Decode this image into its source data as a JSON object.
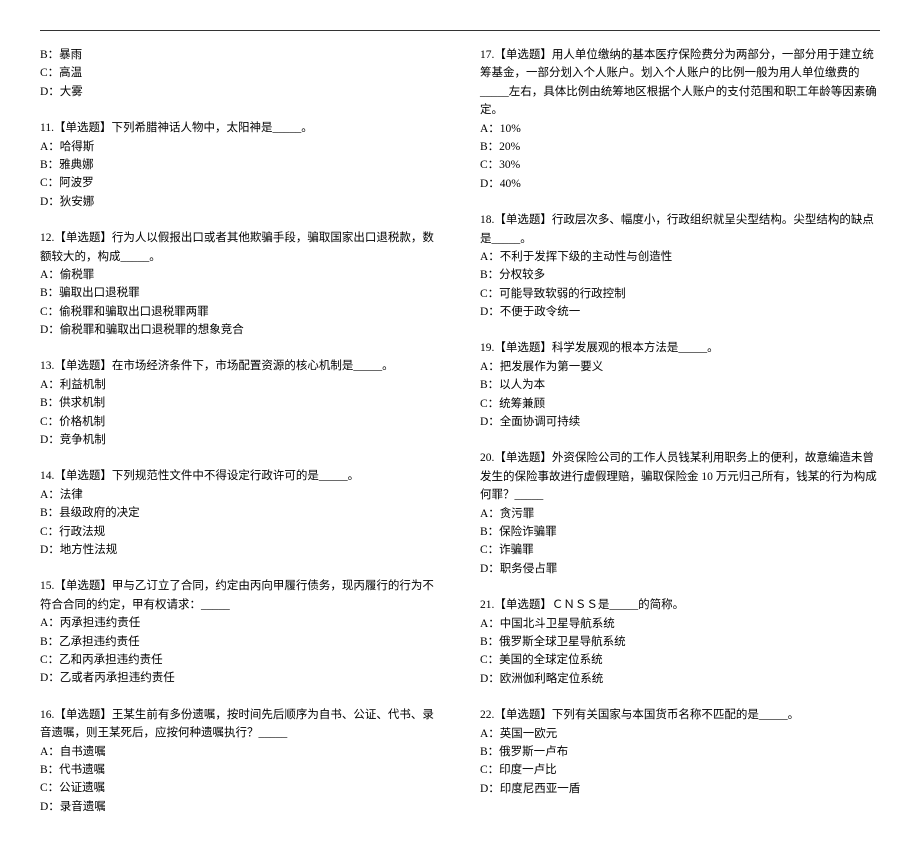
{
  "left": {
    "q10_partial": {
      "B": "B：暴雨",
      "C": "C：高温",
      "D": "D：大雾"
    },
    "q11": {
      "text": "11.【单选题】下列希腊神话人物中，太阳神是_____。",
      "A": "A：哈得斯",
      "B": "B：雅典娜",
      "C": "C：阿波罗",
      "D": "D：狄安娜"
    },
    "q12": {
      "text": "12.【单选题】行为人以假报出口或者其他欺骗手段，骗取国家出口退税款，数额较大的，构成_____。",
      "A": "A：偷税罪",
      "B": "B：骗取出口退税罪",
      "C": "C：偷税罪和骗取出口退税罪两罪",
      "D": "D：偷税罪和骗取出口退税罪的想象竞合"
    },
    "q13": {
      "text": "13.【单选题】在市场经济条件下，市场配置资源的核心机制是_____。",
      "A": "A：利益机制",
      "B": "B：供求机制",
      "C": "C：价格机制",
      "D": "D：竞争机制"
    },
    "q14": {
      "text": "14.【单选题】下列规范性文件中不得设定行政许可的是_____。",
      "A": "A：法律",
      "B": "B：县级政府的决定",
      "C": "C：行政法规",
      "D": "D：地方性法规"
    },
    "q15": {
      "text": "15.【单选题】甲与乙订立了合同，约定由丙向甲履行债务，现丙履行的行为不符合合同的约定，甲有权请求：_____",
      "A": "A：丙承担违约责任",
      "B": "B：乙承担违约责任",
      "C": "C：乙和丙承担违约责任",
      "D": "D：乙或者丙承担违约责任"
    },
    "q16": {
      "text": "16.【单选题】王某生前有多份遗嘱，按时间先后顺序为自书、公证、代书、录音遗嘱，则王某死后，应按何种遗嘱执行？_____",
      "A": "A：自书遗嘱",
      "B": "B：代书遗嘱",
      "C": "C：公证遗嘱",
      "D": "D：录音遗嘱"
    }
  },
  "right": {
    "q17": {
      "text": "17.【单选题】用人单位缴纳的基本医疗保险费分为两部分，一部分用于建立统筹基金，一部分划入个人账户。划入个人账户的比例一般为用人单位缴费的_____左右，具体比例由统筹地区根据个人账户的支付范围和职工年龄等因素确定。",
      "A": "A：10%",
      "B": "B：20%",
      "C": "C：30%",
      "D": "D：40%"
    },
    "q18": {
      "text": "18.【单选题】行政层次多、幅度小，行政组织就呈尖型结构。尖型结构的缺点是_____。",
      "A": "A：不利于发挥下级的主动性与创造性",
      "B": "B：分权较多",
      "C": "C：可能导致软弱的行政控制",
      "D": "D：不便于政令统一"
    },
    "q19": {
      "text": "19.【单选题】科学发展观的根本方法是_____。",
      "A": "A：把发展作为第一要义",
      "B": "B：以人为本",
      "C": "C：统筹兼顾",
      "D": "D：全面协调可持续"
    },
    "q20": {
      "text": "20.【单选题】外资保险公司的工作人员钱某利用职务上的便利，故意编造未曾发生的保险事故进行虚假理赔，骗取保险金 10 万元归己所有，钱某的行为构成何罪？_____",
      "A": "A：贪污罪",
      "B": "B：保险诈骗罪",
      "C": "C：诈骗罪",
      "D": "D：职务侵占罪"
    },
    "q21": {
      "text": "21.【单选题】ＣＮＳＳ是_____的简称。",
      "A": "A：中国北斗卫星导航系统",
      "B": "B：俄罗斯全球卫星导航系统",
      "C": "C：美国的全球定位系统",
      "D": "D：欧洲伽利略定位系统"
    },
    "q22": {
      "text": "22.【单选题】下列有关国家与本国货币名称不匹配的是_____。",
      "A": "A：英国一欧元",
      "B": "B：俄罗斯一卢布",
      "C": "C：印度一卢比",
      "D": "D：印度尼西亚一盾"
    }
  }
}
